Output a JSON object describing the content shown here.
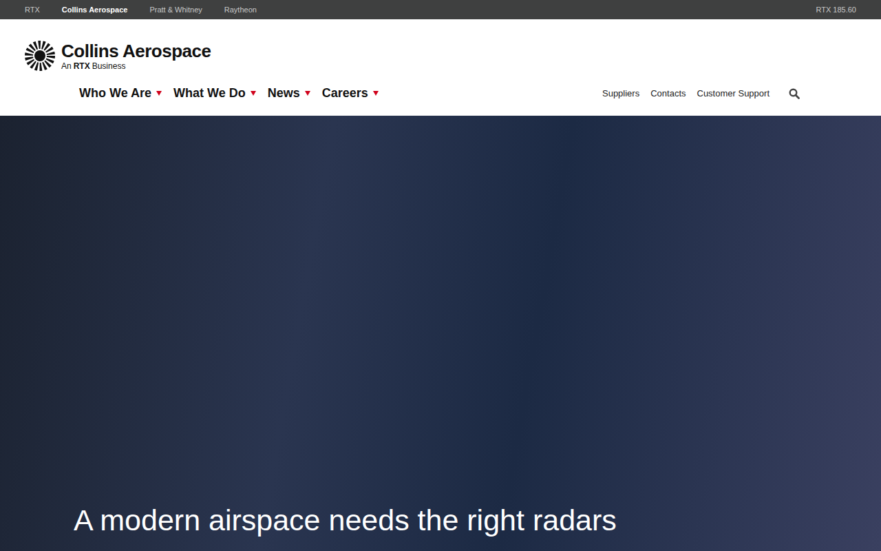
{
  "top_bar": {
    "brands": [
      {
        "label": "RTX",
        "selected": false
      },
      {
        "label": "Collins Aerospace",
        "selected": true
      },
      {
        "label": "Pratt & Whitney",
        "selected": false
      },
      {
        "label": "Raytheon",
        "selected": false
      }
    ],
    "stock": "RTX 185.60"
  },
  "logo": {
    "name": "Collins Aerospace",
    "tagline_prefix": "An",
    "tagline_brand": "RTX",
    "tagline_suffix": "Business"
  },
  "nav": {
    "primary": [
      "Who We Are",
      "What We Do",
      "News",
      "Careers"
    ],
    "utility": [
      "Suppliers",
      "Contacts",
      "Customer Support"
    ]
  },
  "hero": {
    "headline": "A modern airspace needs the right radars"
  }
}
